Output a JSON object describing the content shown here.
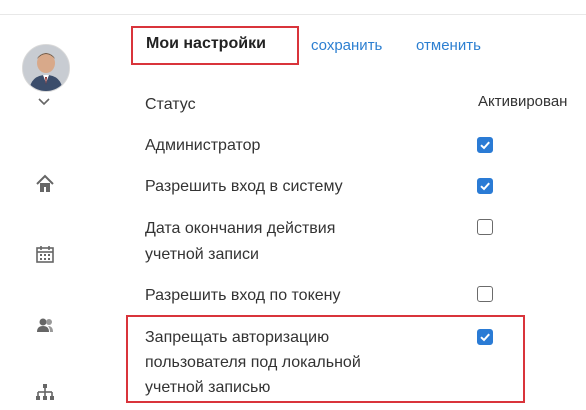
{
  "header": {
    "title": "Мои настройки",
    "save_label": "сохранить",
    "cancel_label": "отменить"
  },
  "settings": {
    "status": {
      "label": "Статус",
      "value": "Активирован"
    },
    "rows": [
      {
        "label": "Администратор",
        "checked": true
      },
      {
        "label": "Разрешить вход в систему",
        "checked": true
      },
      {
        "label_line1": "Дата окончания действия",
        "label_line2": "учетной записи",
        "checked": false
      },
      {
        "label": "Разрешить вход по токену",
        "checked": false
      },
      {
        "label_line1": "Запрещать авторизацию",
        "label_line2": "пользователя под локальной",
        "label_line3": "учетной записью",
        "checked": true
      }
    ]
  },
  "nav": {
    "icons": [
      "avatar",
      "chevron-down-icon",
      "home-icon",
      "calendar-icon",
      "users-icon",
      "org-chart-icon"
    ]
  },
  "colors": {
    "accent": "#2a7bd5",
    "link": "#2c7fd1",
    "highlight": "#d9343b"
  }
}
